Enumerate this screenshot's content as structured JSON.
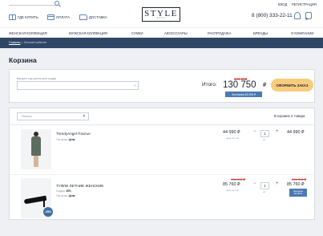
{
  "header": {
    "links": {
      "gifts": "ГДЕ КУПИТЬ",
      "payment": "ОПЛАТА",
      "delivery": "ДОСТАВКА"
    },
    "logo": {
      "main": "STYLE",
      "sub": "BUTIK"
    },
    "account": {
      "login": "ВХОД",
      "register": "РЕГИСТРАЦИЯ"
    },
    "phone": "8 (800) 333-22-11",
    "cart_count": "0"
  },
  "nav": {
    "items": [
      "ЖЕНСКАЯ КОЛЛЕКЦИЯ",
      "МУЖСКАЯ КОЛЛЕКЦИЯ",
      "СУМКИ",
      "АКСЕССУАРЫ",
      "РАСПРОДАЖА",
      "БРЕНДЫ",
      "О КОМПАНИИ"
    ]
  },
  "breadcrumb": {
    "home": "Главная",
    "sep": ">",
    "current": "Личный кабинет"
  },
  "page_title": "Корзина",
  "summary": {
    "promo_label": "Введите код купона для скидки",
    "total_label": "Итого:",
    "old_total": "179 000",
    "total": "130 750",
    "currency": "₽",
    "savings": "Экономия 48 250 ₽",
    "checkout_label": "ОФОРМИТЬ ЗАКАЗ"
  },
  "list": {
    "filter_placeholder": "Фильтр",
    "cart_count_text": "В корзине 2 товара",
    "items": [
      {
        "name": "TrendyAngel Платье",
        "meta_label": "Тип цены:",
        "meta_value": "Цена",
        "unit_price": "44 990 ₽",
        "unit_note": "цена за 1 шт",
        "qty": "1",
        "qty_unit": "шт",
        "line_price": "44 990 ₽"
      },
      {
        "name": "ТУФЛИ ЛЕТНИЕ ЖЕНСКИЕ",
        "discount_label": "Скидка:",
        "discount_value": "35%",
        "meta_label": "Тип цены:",
        "meta_value": "Цена",
        "unit_old": "134 010 ₽",
        "unit_price": "85 760 ₽",
        "unit_note": "цена за 1 шт",
        "qty": "1",
        "qty_unit": "шт",
        "line_old": "134 010 ₽",
        "line_price": "85 760 ₽",
        "line_badge_1": "Экономия",
        "line_badge_2": "48 250 ₽",
        "badge": "-35%"
      }
    ]
  }
}
